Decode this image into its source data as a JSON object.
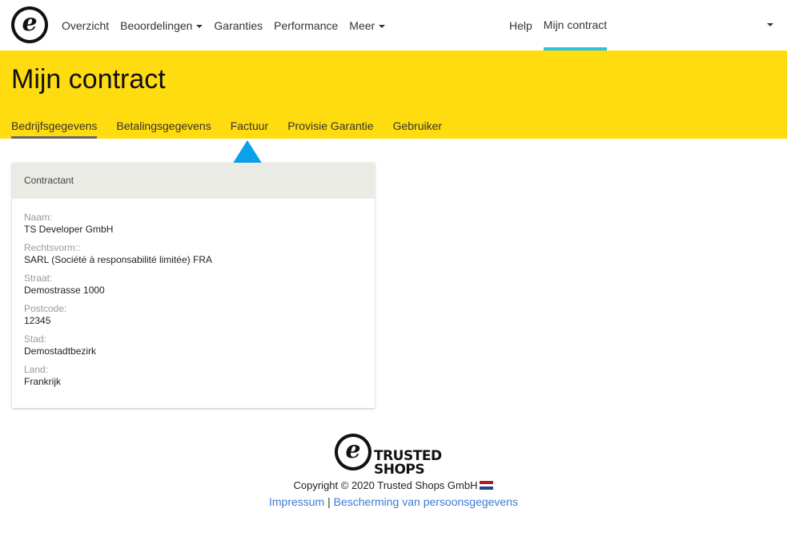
{
  "navbar": {
    "logo_icon": "trusted-shops-e-icon",
    "items": [
      {
        "label": "Overzicht",
        "dropdown": false
      },
      {
        "label": "Beoordelingen",
        "dropdown": true
      },
      {
        "label": "Garanties",
        "dropdown": false
      },
      {
        "label": "Performance",
        "dropdown": false
      },
      {
        "label": "Meer",
        "dropdown": true
      }
    ],
    "right_items": [
      {
        "label": "Help",
        "active": false
      },
      {
        "label": "Mijn contract",
        "active": true
      }
    ],
    "active_color": "#2cc4d6"
  },
  "header": {
    "title": "Mijn contract",
    "background": "#ffdc0f",
    "tabs": [
      {
        "label": "Bedrijfsgegevens",
        "active": true
      },
      {
        "label": "Betalingsgegevens",
        "active": false
      },
      {
        "label": "Factuur",
        "active": false
      },
      {
        "label": "Provisie Garantie",
        "active": false
      },
      {
        "label": "Gebruiker",
        "active": false
      }
    ]
  },
  "annotation": {
    "icon": "arrow-up-icon",
    "color": "#0aa1ea"
  },
  "card": {
    "title": "Contractant",
    "fields": [
      {
        "label": "Naam:",
        "value": "TS Developer GmbH"
      },
      {
        "label": "Rechtsvorm::",
        "value": "SARL (Société à responsabilité limitée) FRA"
      },
      {
        "label": "Straat:",
        "value": "Demostrasse 1000"
      },
      {
        "label": "Postcode:",
        "value": "12345"
      },
      {
        "label": "Stad:",
        "value": "Demostadtbezirk"
      },
      {
        "label": "Land:",
        "value": "Frankrijk"
      }
    ]
  },
  "footer": {
    "logo_line1": "TRUSTED",
    "logo_line2": "SHOPS",
    "copyright": "Copyright © 2020 Trusted Shops GmbH",
    "flag_icon": "netherlands-flag-icon",
    "links": [
      {
        "label": "Impressum"
      },
      {
        "label": "Bescherming van persoonsgegevens"
      }
    ],
    "separator": "|",
    "link_color": "#3a7bd5"
  }
}
